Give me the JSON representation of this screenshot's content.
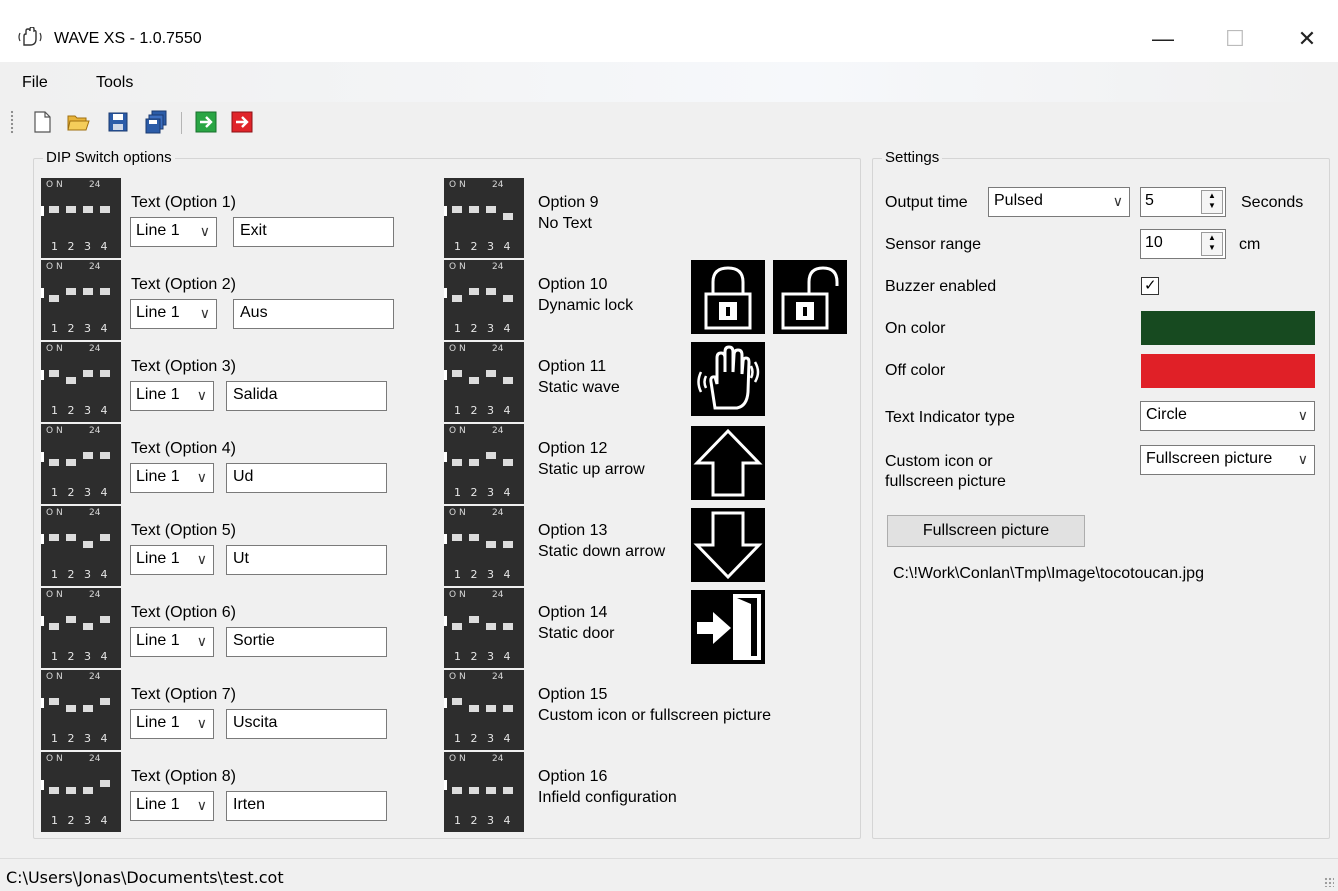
{
  "window": {
    "title": "WAVE XS - 1.0.7550",
    "minimize_glyph": "—",
    "maximize_glyph": "☐",
    "close_glyph": "✕"
  },
  "menu": {
    "items": [
      "File",
      "Tools"
    ]
  },
  "toolbar": {
    "buttons": [
      "new-icon",
      "open-folder-icon",
      "save-icon",
      "save-all-icon",
      "import-icon",
      "export-icon"
    ]
  },
  "dip_group": {
    "title": "DIP Switch options",
    "on_label": "O N",
    "count_label": "24",
    "numbers": "1 2 3 4",
    "text_options": [
      {
        "label": "Text (Option 1)",
        "line": "Line 1",
        "text": "Exit"
      },
      {
        "label": "Text (Option 2)",
        "line": "Line 1",
        "text": "Aus"
      },
      {
        "label": "Text (Option 3)",
        "line": "Line 1",
        "text": "Salida"
      },
      {
        "label": "Text (Option 4)",
        "line": "Line 1",
        "text": "Ud"
      },
      {
        "label": "Text (Option 5)",
        "line": "Line 1",
        "text": "Ut"
      },
      {
        "label": "Text (Option 6)",
        "line": "Line 1",
        "text": "Sortie"
      },
      {
        "label": "Text (Option 7)",
        "line": "Line 1",
        "text": "Uscita"
      },
      {
        "label": "Text (Option 8)",
        "line": "Line 1",
        "text": "Irten"
      }
    ],
    "icon_options": [
      {
        "title": "Option 9",
        "desc": "No Text"
      },
      {
        "title": "Option 10",
        "desc": "Dynamic lock"
      },
      {
        "title": "Option 11",
        "desc": "Static wave"
      },
      {
        "title": "Option 12",
        "desc": "Static up arrow"
      },
      {
        "title": "Option 13",
        "desc": "Static down arrow"
      },
      {
        "title": "Option 14",
        "desc": "Static door"
      },
      {
        "title": "Option 15",
        "desc": "Custom icon or fullscreen picture"
      },
      {
        "title": "Option 16",
        "desc": "Infield configuration"
      }
    ],
    "combo_arrow": "∨"
  },
  "settings": {
    "title": "Settings",
    "output_time_label": "Output time",
    "output_time_mode": "Pulsed",
    "output_time_value": "5",
    "output_time_unit": "Seconds",
    "sensor_range_label": "Sensor range",
    "sensor_range_value": "10",
    "sensor_range_unit": "cm",
    "buzzer_label": "Buzzer enabled",
    "buzzer_checked": true,
    "check_glyph": "✓",
    "on_color_label": "On color",
    "on_color": "#174a20",
    "off_color_label": "Off color",
    "off_color": "#e02027",
    "text_indicator_label": "Text Indicator type",
    "text_indicator_value": "Circle",
    "custom_icon_label_1": "Custom icon or",
    "custom_icon_label_2": "fullscreen picture",
    "custom_icon_value": "Fullscreen picture",
    "fullscreen_button": "Fullscreen picture",
    "picture_path": "C:\\!Work\\Conlan\\Tmp\\Image\\tocotoucan.jpg"
  },
  "status": {
    "path": "C:\\Users\\Jonas\\Documents\\test.cot"
  }
}
